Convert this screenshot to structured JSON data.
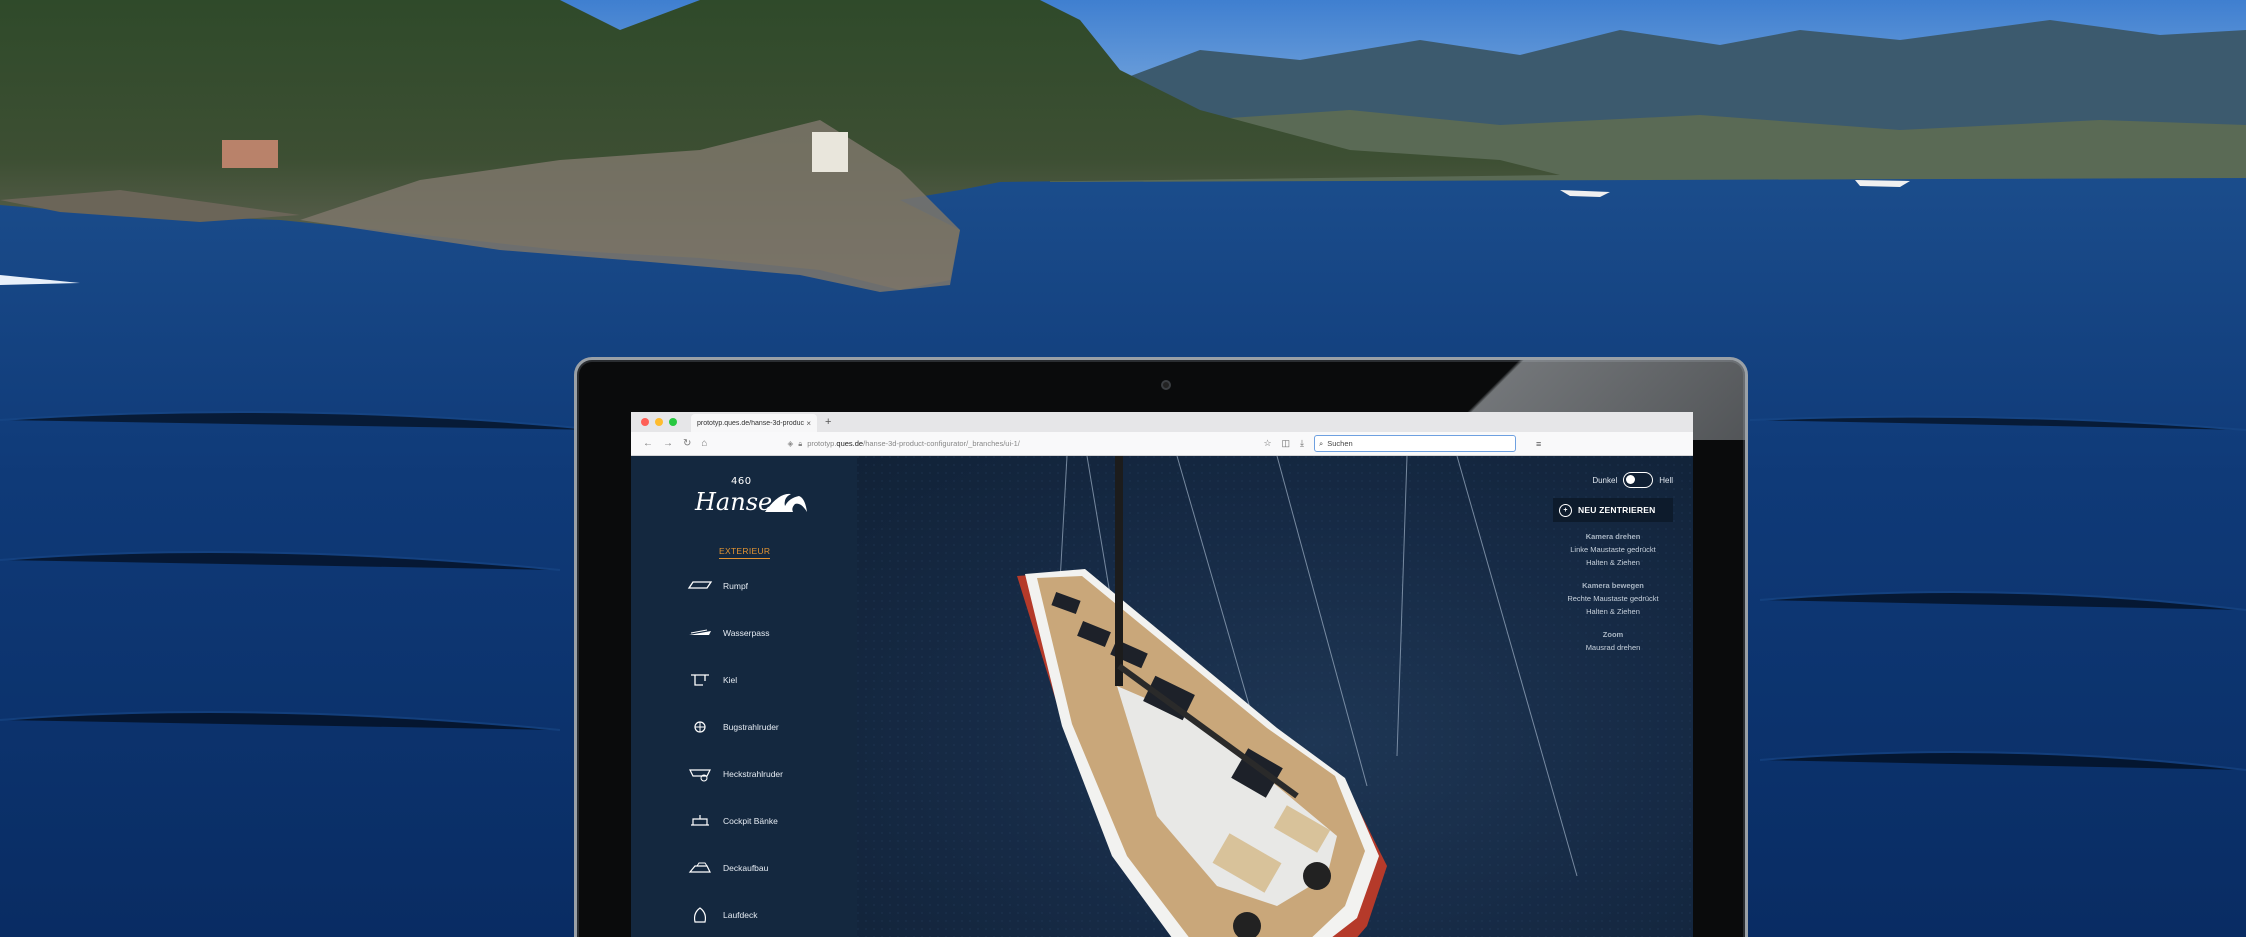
{
  "browser": {
    "tab_title": "prototyp.ques.de/hanse-3d-produc",
    "tab_close": "×",
    "new_tab": "+",
    "url_prefix": "prototyp.",
    "url_domain": "ques.de",
    "url_path": "/hanse-3d-product-configurator/_branches/ui-1/",
    "search_placeholder": "Suchen"
  },
  "brand": {
    "model_number": "460",
    "logo_word": "Hanse"
  },
  "sidebar": {
    "section_label": "EXTERIEUR",
    "items": [
      {
        "label": "Rumpf",
        "icon": "hull-icon"
      },
      {
        "label": "Wasserpass",
        "icon": "waterline-icon"
      },
      {
        "label": "Kiel",
        "icon": "keel-icon"
      },
      {
        "label": "Bugstrahlruder",
        "icon": "bow-thruster-icon"
      },
      {
        "label": "Heckstrahlruder",
        "icon": "stern-thruster-icon"
      },
      {
        "label": "Cockpit Bänke",
        "icon": "cockpit-bench-icon"
      },
      {
        "label": "Deckaufbau",
        "icon": "deck-structure-icon"
      },
      {
        "label": "Laufdeck",
        "icon": "walk-deck-icon"
      }
    ]
  },
  "viewer": {
    "theme_dark": "Dunkel",
    "theme_light": "Hell",
    "recenter_label": "NEU ZENTRIEREN",
    "help": [
      {
        "title": "Kamera drehen",
        "lines": [
          "Linke Maustaste gedrückt",
          "Halten & Ziehen"
        ]
      },
      {
        "title": "Kamera bewegen",
        "lines": [
          "Rechte Maustaste gedrückt",
          "Halten & Ziehen"
        ]
      },
      {
        "title": "Zoom",
        "lines": [
          "Mausrad drehen"
        ]
      }
    ]
  },
  "colors": {
    "accent": "#e39432",
    "sidebar_bg": "#14283f",
    "hull_red": "#b53a2a",
    "deck_teak": "#c9a77a"
  }
}
